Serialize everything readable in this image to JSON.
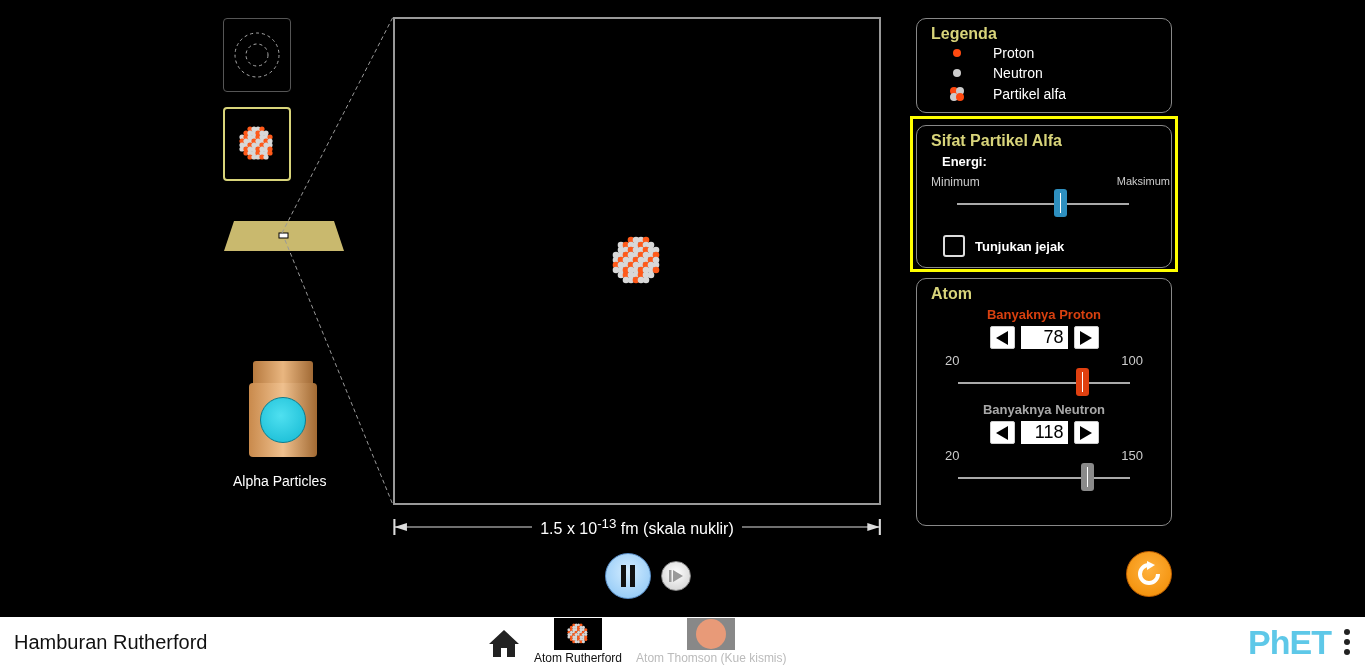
{
  "view_buttons": [
    {
      "kind": "orbits",
      "selected": false
    },
    {
      "kind": "nucleus",
      "selected": true
    }
  ],
  "gun": {
    "label": "Alpha Particles"
  },
  "scale": {
    "value": "1.5 x 10$^{-13}$ fm (skala nuklir)"
  },
  "playback": {
    "playing": true
  },
  "legend": {
    "title": "Legenda",
    "items": [
      {
        "kind": "proton",
        "label": "Proton"
      },
      {
        "kind": "neutron",
        "label": "Neutron"
      },
      {
        "kind": "alpha",
        "label": "Partikel alfa"
      }
    ]
  },
  "alpha_properties": {
    "title": "Sifat Partikel Alfa",
    "highlighted": true,
    "energy_label": "Energi:",
    "min_label": "Minimum",
    "max_label": "Maksimum",
    "level": 0.6,
    "show_traces": {
      "label": "Tunjukan jejak",
      "checked": false
    }
  },
  "atom": {
    "title": "Atom",
    "controls": [
      {
        "kind": "proton",
        "label": "Banyaknya Proton",
        "value": "78",
        "min": "20",
        "max": "100",
        "level": 0.725
      },
      {
        "kind": "neutron",
        "label": "Banyaknya Neutron",
        "value": "118",
        "min": "20",
        "max": "150",
        "level": 0.754
      }
    ]
  },
  "footer": {
    "title": "Hamburan Rutherford",
    "screens": [
      {
        "kind": "rutherford",
        "label": "Atom Rutherford",
        "selected": true
      },
      {
        "kind": "thomson",
        "label": "Atom Thomson (Kue kismis)",
        "selected": false
      }
    ],
    "logo": "PhET"
  }
}
